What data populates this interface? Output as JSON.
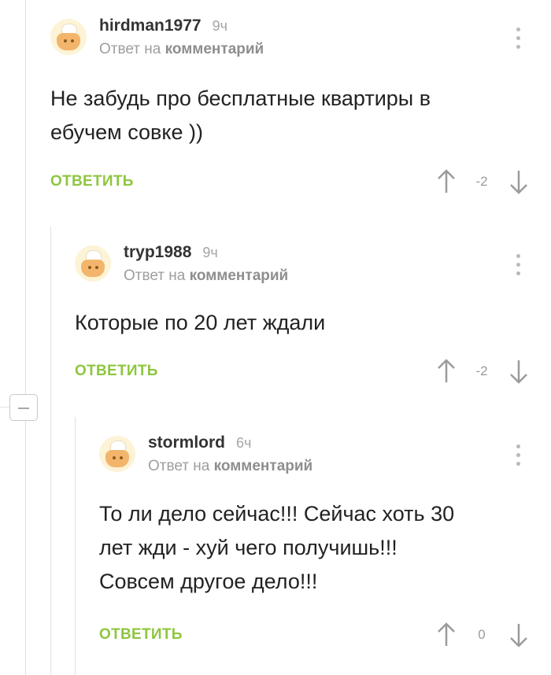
{
  "thread": {
    "comments": [
      {
        "author": "hirdman1977",
        "time": "9ч",
        "reply_prefix": "Ответ на",
        "reply_link": "комментарий",
        "text_lines": [
          "Не забудь про бесплатные квартиры в",
          "ебучем совке ))"
        ],
        "reply_label": "ОТВЕТИТЬ",
        "score": "-2"
      },
      {
        "author": "tryp1988",
        "time": "9ч",
        "reply_prefix": "Ответ на",
        "reply_link": "комментарий",
        "text_lines": [
          "Которые по 20 лет ждали"
        ],
        "reply_label": "ОТВЕТИТЬ",
        "score": "-2"
      },
      {
        "author": "stormlord",
        "time": "6ч",
        "reply_prefix": "Ответ на",
        "reply_link": "комментарий",
        "text_lines": [
          "То ли дело сейчас!!! Сейчас хоть 30",
          "лет жди - хуй чего получишь!!!",
          "Совсем другое дело!!!"
        ],
        "reply_label": "ОТВЕТИТЬ",
        "score": "0"
      }
    ]
  },
  "colors": {
    "reply_green": "#8ec63f",
    "muted_gray": "#9e9e9e",
    "thread_line": "#e2e2e2"
  }
}
